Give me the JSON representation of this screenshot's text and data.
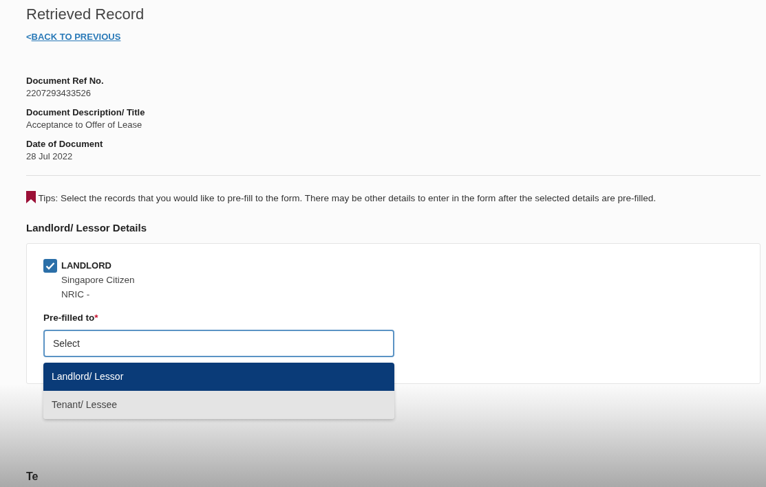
{
  "page": {
    "title": "Retrieved Record",
    "back_link": {
      "icon": "<",
      "label": "BACK TO PREVIOUS"
    }
  },
  "fields": [
    {
      "label": "Document Ref No.",
      "value": "2207293433526"
    },
    {
      "label": "Document Description/ Title",
      "value": "Acceptance to Offer of Lease"
    },
    {
      "label": "Date of Document",
      "value": "28 Jul 2022"
    }
  ],
  "tips": "Tips: Select the records that you would like to pre-fill to the form. There may be other details to enter in the form after the selected details are pre-filled.",
  "section": {
    "heading": "Landlord/ Lessor Details",
    "party": {
      "checked": true,
      "role": "LANDLORD",
      "type": "Singapore Citizen",
      "id_line": "NRIC -"
    },
    "prefill": {
      "label": "Pre-filled to",
      "required_mark": "*",
      "placeholder": "Select",
      "options": [
        {
          "label": "Landlord/ Lessor",
          "selected": true
        },
        {
          "label": "Tenant/ Lessee",
          "selected": false
        }
      ]
    }
  },
  "next_section": {
    "heading": "Te"
  }
}
